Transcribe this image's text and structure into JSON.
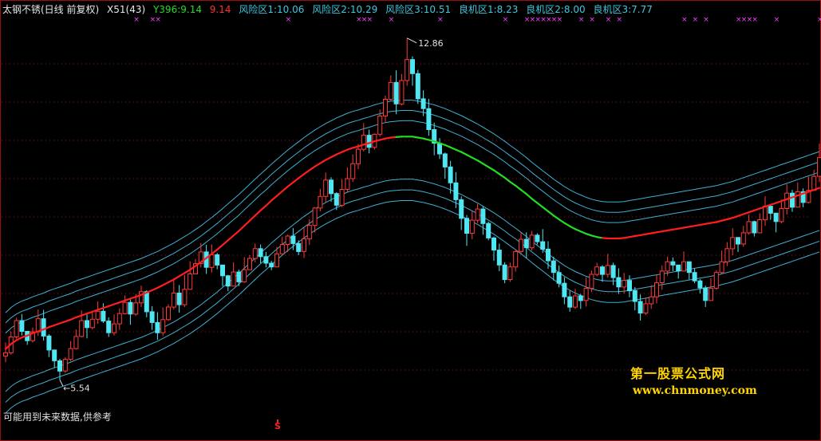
{
  "header": {
    "title": "太钢不锈(日线 前复权)",
    "indicator": "X51(43)",
    "y_value": "Y396:9.14",
    "r_value": "9.14",
    "risk1": "风险区1:10.06",
    "risk2": "风险区2:10.29",
    "risk3": "风险区3:10.51",
    "buy1": "良机区1:8.23",
    "buy2": "良机区2:8.00",
    "buy3": "良机区3:7.77"
  },
  "footer_note": "可能用到未来数据,供参考",
  "watermark": {
    "cn": "第一股票公式网",
    "url": "www.chnmoney.com"
  },
  "s_marker": "S",
  "colors": {
    "background": "#000000",
    "rising": "#ff3a3a",
    "falling": "#4fe7f2",
    "ma_up": "#ff1e1e",
    "ma_down": "#22dd22",
    "bands": "#3fb0d0",
    "grid": "#aa1111",
    "marker": "#ff40ff"
  },
  "chart_data": {
    "type": "candlestick",
    "y_range": [
      5.0,
      13.3
    ],
    "annotations": [
      {
        "label": "12.86",
        "value": 12.86,
        "kind": "high"
      },
      {
        "label": "5.54",
        "value": 5.54,
        "kind": "low"
      }
    ],
    "candles": [
      [
        6.05,
        6.12,
        5.92,
        6.34
      ],
      [
        6.12,
        6.46,
        6.08,
        6.58
      ],
      [
        6.46,
        6.81,
        6.42,
        6.87
      ],
      [
        6.81,
        6.58,
        6.49,
        6.95
      ],
      [
        6.58,
        6.38,
        6.29,
        6.47
      ],
      [
        6.38,
        6.57,
        6.34,
        6.66
      ],
      [
        6.57,
        6.85,
        6.48,
        7.05
      ],
      [
        6.85,
        6.48,
        6.38,
        7.04
      ],
      [
        6.48,
        6.18,
        6.03,
        6.52
      ],
      [
        6.18,
        5.95,
        5.8,
        6.19
      ],
      [
        5.95,
        5.73,
        5.54,
        5.99
      ],
      [
        5.73,
        5.98,
        5.69,
        6.03
      ],
      [
        5.98,
        6.21,
        5.94,
        6.37
      ],
      [
        6.21,
        6.47,
        6.19,
        6.62
      ],
      [
        6.47,
        6.81,
        6.45,
        7.03
      ],
      [
        6.81,
        6.66,
        6.43,
        6.94
      ],
      [
        6.66,
        6.84,
        6.62,
        6.98
      ],
      [
        6.84,
        7.01,
        6.74,
        7.22
      ],
      [
        7.01,
        6.8,
        6.76,
        7.18
      ],
      [
        6.8,
        6.55,
        6.46,
        6.88
      ],
      [
        6.55,
        6.74,
        6.49,
        6.94
      ],
      [
        6.74,
        6.96,
        6.61,
        7.07
      ],
      [
        6.96,
        7.2,
        6.94,
        7.35
      ],
      [
        7.2,
        6.95,
        6.72,
        7.29
      ],
      [
        6.95,
        7.19,
        6.91,
        7.38
      ],
      [
        7.19,
        7.43,
        7.1,
        7.56
      ],
      [
        7.43,
        7.0,
        6.88,
        7.46
      ],
      [
        7.0,
        6.77,
        6.61,
        7.12
      ],
      [
        6.77,
        6.55,
        6.4,
        6.99
      ],
      [
        6.55,
        6.83,
        6.48,
        7.09
      ],
      [
        6.83,
        7.1,
        6.8,
        7.16
      ],
      [
        7.1,
        7.4,
        7.05,
        7.67
      ],
      [
        7.4,
        7.15,
        6.98,
        7.57
      ],
      [
        7.15,
        7.48,
        7.1,
        7.79
      ],
      [
        7.48,
        7.81,
        7.47,
        8.08
      ],
      [
        7.81,
        8.03,
        7.81,
        8.13
      ],
      [
        8.03,
        8.28,
        7.95,
        8.47
      ],
      [
        8.28,
        7.95,
        7.81,
        8.43
      ],
      [
        7.95,
        8.22,
        7.84,
        8.44
      ],
      [
        8.22,
        8.0,
        7.91,
        8.26
      ],
      [
        8.0,
        7.77,
        7.54,
        7.8
      ],
      [
        7.77,
        7.55,
        7.44,
        7.79
      ],
      [
        7.55,
        7.85,
        7.54,
        8.06
      ],
      [
        7.85,
        7.64,
        7.55,
        7.9
      ],
      [
        7.64,
        7.9,
        7.62,
        8.17
      ],
      [
        7.9,
        8.14,
        8.03,
        8.21
      ],
      [
        8.14,
        8.35,
        8.06,
        8.46
      ],
      [
        8.35,
        8.18,
        8.04,
        8.44
      ],
      [
        8.18,
        8.04,
        7.95,
        8.28
      ],
      [
        8.04,
        7.96,
        7.89,
        8.09
      ],
      [
        7.96,
        8.24,
        7.95,
        8.39
      ],
      [
        8.24,
        8.44,
        8.24,
        8.61
      ],
      [
        8.44,
        8.62,
        8.28,
        8.65
      ],
      [
        8.62,
        8.46,
        8.32,
        8.79
      ],
      [
        8.46,
        8.29,
        8.21,
        8.53
      ],
      [
        8.29,
        8.56,
        8.15,
        8.8
      ],
      [
        8.56,
        8.85,
        8.43,
        8.98
      ],
      [
        8.85,
        9.22,
        8.7,
        9.24
      ],
      [
        9.22,
        9.47,
        9.15,
        9.63
      ],
      [
        9.47,
        9.82,
        9.34,
        9.98
      ],
      [
        9.82,
        9.53,
        9.35,
        9.88
      ],
      [
        9.53,
        9.28,
        9.18,
        9.56
      ],
      [
        9.28,
        9.62,
        9.24,
        9.84
      ],
      [
        9.62,
        9.85,
        9.55,
        10.09
      ],
      [
        9.85,
        10.17,
        9.78,
        10.37
      ],
      [
        10.17,
        10.48,
        10.05,
        10.59
      ],
      [
        10.48,
        10.78,
        10.43,
        11.04
      ],
      [
        10.78,
        10.52,
        10.39,
        10.9
      ],
      [
        10.52,
        10.8,
        10.47,
        10.82
      ],
      [
        10.8,
        11.19,
        10.75,
        11.33
      ],
      [
        11.19,
        11.55,
        11.06,
        11.63
      ],
      [
        11.55,
        11.91,
        11.52,
        12.06
      ],
      [
        11.91,
        11.45,
        11.23,
        12.17
      ],
      [
        11.45,
        11.95,
        11.42,
        12.09
      ],
      [
        11.95,
        12.4,
        11.84,
        12.86
      ],
      [
        12.4,
        12.1,
        11.84,
        12.47
      ],
      [
        12.1,
        11.56,
        11.45,
        12.18
      ],
      [
        11.56,
        11.35,
        11.19,
        11.74
      ],
      [
        11.35,
        10.9,
        10.77,
        11.56
      ],
      [
        10.9,
        10.61,
        10.35,
        11.05
      ],
      [
        10.61,
        10.38,
        10.27,
        10.72
      ],
      [
        10.38,
        10.1,
        9.85,
        10.41
      ],
      [
        10.1,
        9.76,
        9.53,
        10.23
      ],
      [
        9.76,
        9.4,
        9.22,
        9.99
      ],
      [
        9.4,
        9.0,
        8.75,
        9.47
      ],
      [
        9.0,
        8.68,
        8.41,
        9.07
      ],
      [
        8.68,
        8.96,
        8.55,
        9.15
      ],
      [
        8.96,
        9.2,
        8.9,
        9.31
      ],
      [
        9.2,
        8.89,
        8.65,
        9.25
      ],
      [
        8.89,
        8.58,
        8.53,
        8.93
      ],
      [
        8.58,
        8.32,
        8.09,
        8.61
      ],
      [
        8.32,
        8.0,
        7.87,
        8.46
      ],
      [
        8.0,
        7.69,
        7.61,
        8.06
      ],
      [
        7.69,
        7.96,
        7.64,
        8.05
      ],
      [
        7.96,
        8.29,
        7.86,
        8.34
      ],
      [
        8.29,
        8.55,
        8.24,
        8.7
      ],
      [
        8.55,
        8.37,
        8.14,
        8.7
      ],
      [
        8.37,
        8.64,
        8.31,
        8.73
      ],
      [
        8.64,
        8.5,
        8.44,
        8.68
      ],
      [
        8.5,
        8.34,
        8.26,
        8.77
      ],
      [
        8.34,
        8.09,
        7.92,
        8.51
      ],
      [
        8.09,
        7.84,
        7.67,
        8.18
      ],
      [
        7.84,
        7.61,
        7.52,
        7.99
      ],
      [
        7.61,
        7.32,
        7.16,
        7.74
      ],
      [
        7.32,
        7.1,
        7.0,
        7.45
      ],
      [
        7.1,
        7.34,
        7.06,
        7.49
      ],
      [
        7.34,
        7.24,
        7.06,
        7.38
      ],
      [
        7.24,
        7.5,
        7.11,
        7.74
      ],
      [
        7.5,
        7.8,
        7.42,
        7.88
      ],
      [
        7.8,
        7.96,
        7.76,
        8.05
      ],
      [
        7.96,
        7.8,
        7.64,
        8.0
      ],
      [
        7.8,
        7.99,
        7.73,
        8.24
      ],
      [
        7.99,
        7.73,
        7.57,
        8.05
      ],
      [
        7.73,
        7.53,
        7.38,
        7.93
      ],
      [
        7.53,
        7.67,
        7.39,
        7.83
      ],
      [
        7.67,
        7.45,
        7.31,
        7.78
      ],
      [
        7.45,
        7.22,
        7.03,
        7.53
      ],
      [
        7.22,
        6.97,
        6.81,
        7.37
      ],
      [
        6.97,
        7.17,
        6.93,
        7.29
      ],
      [
        7.17,
        7.32,
        7.06,
        7.57
      ],
      [
        7.32,
        7.62,
        7.18,
        7.8
      ],
      [
        7.62,
        7.87,
        7.47,
        7.99
      ],
      [
        7.87,
        8.07,
        7.77,
        8.18
      ],
      [
        8.07,
        8.0,
        7.87,
        8.16
      ],
      [
        8.0,
        7.87,
        7.71,
        7.96
      ],
      [
        7.87,
        8.07,
        7.86,
        8.29
      ],
      [
        8.07,
        7.84,
        7.69,
        8.01
      ],
      [
        7.84,
        7.66,
        7.61,
        7.93
      ],
      [
        7.66,
        7.51,
        7.39,
        7.7
      ],
      [
        7.51,
        7.24,
        7.1,
        7.56
      ],
      [
        7.24,
        7.5,
        7.24,
        7.72
      ],
      [
        7.5,
        7.84,
        7.47,
        7.89
      ],
      [
        7.84,
        8.07,
        7.81,
        8.31
      ],
      [
        8.07,
        8.35,
        7.98,
        8.49
      ],
      [
        8.35,
        8.59,
        8.21,
        8.79
      ],
      [
        8.59,
        8.45,
        8.28,
        8.49
      ],
      [
        8.45,
        8.69,
        8.39,
        8.84
      ],
      [
        8.69,
        8.93,
        8.65,
        9.08
      ],
      [
        8.93,
        8.69,
        8.61,
        8.95
      ],
      [
        8.69,
        8.97,
        8.68,
        9.11
      ],
      [
        8.97,
        9.26,
        8.84,
        9.47
      ],
      [
        9.26,
        9.11,
        8.97,
        9.25
      ],
      [
        9.11,
        8.93,
        8.7,
        9.05
      ],
      [
        8.93,
        9.21,
        8.89,
        9.4
      ],
      [
        9.21,
        9.54,
        9.08,
        9.73
      ],
      [
        9.54,
        9.24,
        9.14,
        9.61
      ],
      [
        9.24,
        9.57,
        9.23,
        9.77
      ],
      [
        9.57,
        9.34,
        9.24,
        9.64
      ],
      [
        9.34,
        9.6,
        9.32,
        9.89
      ],
      [
        9.6,
        9.9,
        9.59,
        10.04
      ],
      [
        9.9,
        10.3,
        9.78,
        10.6
      ]
    ],
    "ma": [
      6.2,
      6.31,
      6.39,
      6.45,
      6.49,
      6.54,
      6.58,
      6.62,
      6.67,
      6.71,
      6.75,
      6.79,
      6.83,
      6.88,
      6.92,
      6.96,
      7.0,
      7.04,
      7.08,
      7.12,
      7.16,
      7.2,
      7.24,
      7.28,
      7.32,
      7.36,
      7.41,
      7.46,
      7.51,
      7.57,
      7.63,
      7.69,
      7.76,
      7.83,
      7.9,
      7.98,
      8.06,
      8.15,
      8.24,
      8.33,
      8.43,
      8.53,
      8.63,
      8.73,
      8.84,
      8.95,
      9.06,
      9.17,
      9.27,
      9.38,
      9.48,
      9.58,
      9.68,
      9.77,
      9.86,
      9.95,
      10.03,
      10.11,
      10.18,
      10.25,
      10.31,
      10.37,
      10.42,
      10.47,
      10.51,
      10.54,
      10.58,
      10.61,
      10.65,
      10.68,
      10.71,
      10.73,
      10.74,
      10.75,
      10.75,
      10.75,
      10.73,
      10.71,
      10.68,
      10.65,
      10.61,
      10.57,
      10.52,
      10.47,
      10.42,
      10.36,
      10.3,
      10.24,
      10.17,
      10.1,
      10.03,
      9.95,
      9.87,
      9.78,
      9.7,
      9.61,
      9.52,
      9.42,
      9.33,
      9.24,
      9.15,
      9.06,
      8.98,
      8.9,
      8.83,
      8.77,
      8.72,
      8.67,
      8.63,
      8.6,
      8.58,
      8.57,
      8.57,
      8.57,
      8.58,
      8.6,
      8.62,
      8.64,
      8.66,
      8.68,
      8.7,
      8.72,
      8.74,
      8.76,
      8.78,
      8.8,
      8.82,
      8.84,
      8.86,
      8.88,
      8.9,
      8.92,
      8.95,
      8.98,
      9.01,
      9.05,
      9.09,
      9.13,
      9.17,
      9.21,
      9.25,
      9.29,
      9.33,
      9.37,
      9.41,
      9.45,
      9.49,
      9.53,
      9.57,
      9.61,
      9.65
    ],
    "ma_up": [
      true,
      true,
      true,
      true,
      true,
      true,
      true,
      true,
      true,
      true,
      true,
      true,
      true,
      true,
      true,
      true,
      true,
      true,
      true,
      true,
      true,
      true,
      true,
      true,
      true,
      true,
      true,
      true,
      true,
      true,
      true,
      true,
      true,
      true,
      true,
      true,
      true,
      true,
      true,
      true,
      true,
      true,
      true,
      true,
      true,
      true,
      true,
      true,
      true,
      true,
      true,
      true,
      true,
      true,
      true,
      true,
      true,
      true,
      true,
      true,
      true,
      true,
      true,
      true,
      true,
      true,
      true,
      true,
      true,
      true,
      true,
      true,
      true,
      false,
      false,
      false,
      false,
      false,
      false,
      false,
      false,
      false,
      false,
      false,
      false,
      false,
      false,
      false,
      false,
      false,
      false,
      false,
      false,
      false,
      false,
      false,
      false,
      false,
      false,
      false,
      false,
      false,
      false,
      false,
      false,
      false,
      false,
      false,
      false,
      false,
      false,
      true,
      true,
      true,
      true,
      true,
      true,
      true,
      true,
      true,
      true,
      true,
      true,
      true,
      true,
      true,
      true,
      true,
      true,
      true,
      true,
      true,
      true,
      true,
      true,
      true,
      true,
      true,
      true,
      true,
      true,
      true,
      true,
      true,
      true,
      true,
      true,
      true,
      true,
      true,
      true
    ],
    "band_offsets_upper": [
      0.34,
      0.56,
      0.78
    ],
    "band_offsets_lower": [
      0.91,
      1.14,
      1.37
    ],
    "markers_top_indices": [
      24,
      27,
      28,
      52,
      65,
      66,
      67,
      71,
      80,
      92,
      96,
      97,
      98,
      99,
      100,
      101,
      102,
      106,
      108,
      111,
      113,
      125,
      127,
      129,
      135,
      136,
      137,
      138,
      142,
      150
    ]
  }
}
